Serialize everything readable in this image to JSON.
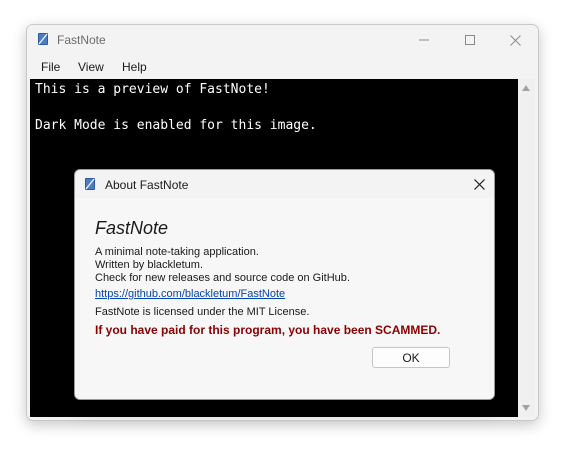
{
  "window": {
    "title": "FastNote",
    "menu": [
      "File",
      "View",
      "Help"
    ],
    "editor_lines": [
      "This is a preview of FastNote!",
      "",
      "Dark Mode is enabled for this image."
    ]
  },
  "dialog": {
    "title": "About FastNote",
    "app_name": "FastNote",
    "description": "A minimal note-taking application.",
    "author": "Written by blackletum.",
    "releases_note": "Check for new releases and source code on GitHub.",
    "link": "https://github.com/blackletum/FastNote",
    "license": "FastNote is licensed under the MIT License.",
    "warning": "If you have paid for this program, you have been SCAMMED.",
    "ok_label": "OK"
  },
  "icons": {
    "app": "notebook-icon",
    "minimize": "minimize-icon",
    "maximize": "maximize-icon",
    "close": "close-icon"
  },
  "colors": {
    "editor_bg": "#000000",
    "editor_fg": "#ffffff",
    "warning": "#8b0000",
    "link": "#0645ad",
    "app_icon": "#2c5aa0"
  }
}
